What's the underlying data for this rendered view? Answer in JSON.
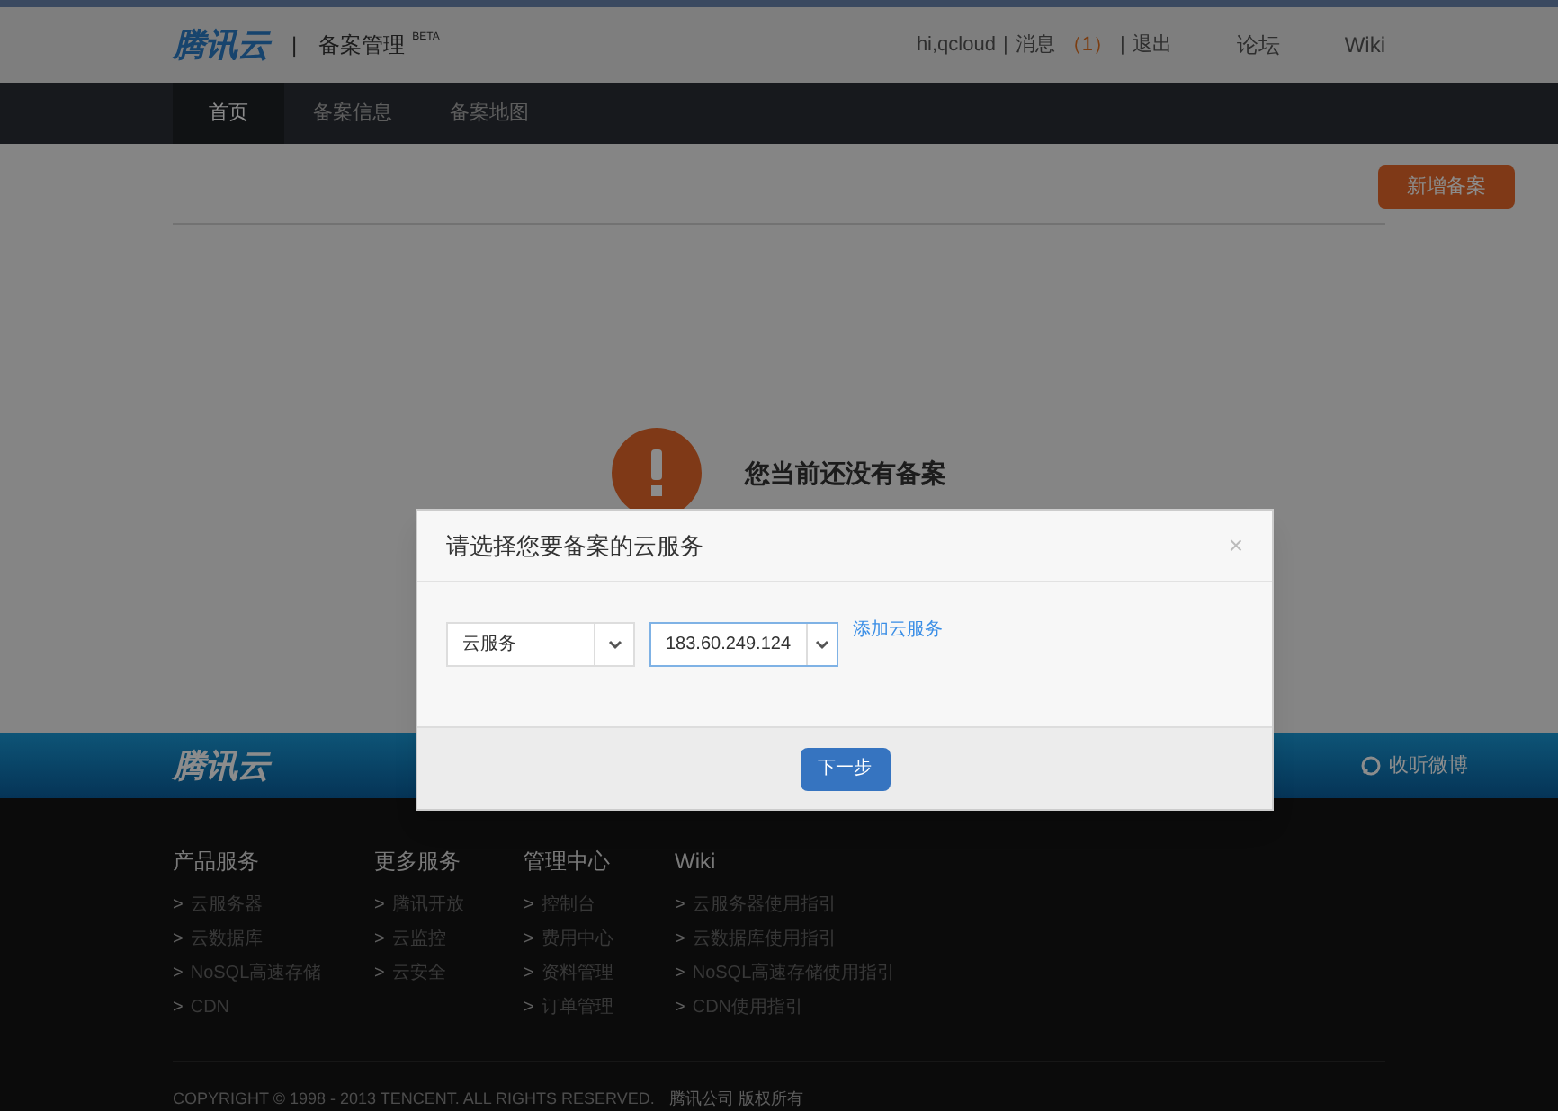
{
  "header": {
    "logo": "腾讯云",
    "separator": "|",
    "title": "备案管理",
    "badge": "BETA",
    "user": "hi,qcloud",
    "user_separators": [
      "|",
      "|"
    ],
    "messages_label": "消息",
    "messages_count": "（1）",
    "logout": "退出",
    "links": [
      "论坛",
      "Wiki"
    ]
  },
  "nav": {
    "tabs": [
      {
        "label": "首页",
        "selected": true
      },
      {
        "label": "备案信息",
        "selected": false
      },
      {
        "label": "备案地图",
        "selected": false
      }
    ]
  },
  "toolbar": {
    "button": "新增备案"
  },
  "empty_state": {
    "message": "您当前还没有备案"
  },
  "dialog": {
    "title": "请选择您要备案的云服务",
    "close": "×",
    "selects": [
      {
        "value": "云服务",
        "focused": false
      },
      {
        "value": "183.60.249.124",
        "focused": true
      }
    ],
    "link": "添加云服务",
    "button": "下一步"
  },
  "footer_band": {
    "logo": "腾讯云",
    "weibo": "收听微博"
  },
  "footer": {
    "columns": [
      {
        "heading": "产品服务",
        "items": [
          "云服务器",
          "云数据库",
          "NoSQL高速存储",
          "CDN"
        ]
      },
      {
        "heading": "更多服务",
        "items": [
          "腾讯开放",
          "云监控",
          "云安全"
        ]
      },
      {
        "heading": "管理中心",
        "items": [
          "控制台",
          "费用中心",
          "资料管理",
          "订单管理"
        ]
      },
      {
        "heading": "Wiki",
        "items": [
          "云服务器使用指引",
          "云数据库使用指引",
          "NoSQL高速存储使用指引",
          "CDN使用指引"
        ]
      }
    ],
    "item_marker": ">",
    "copyright": "COPYRIGHT © 1998 - 2013 TENCENT. ALL RIGHTS RESERVED.",
    "company": "腾讯公司 版权所有"
  }
}
